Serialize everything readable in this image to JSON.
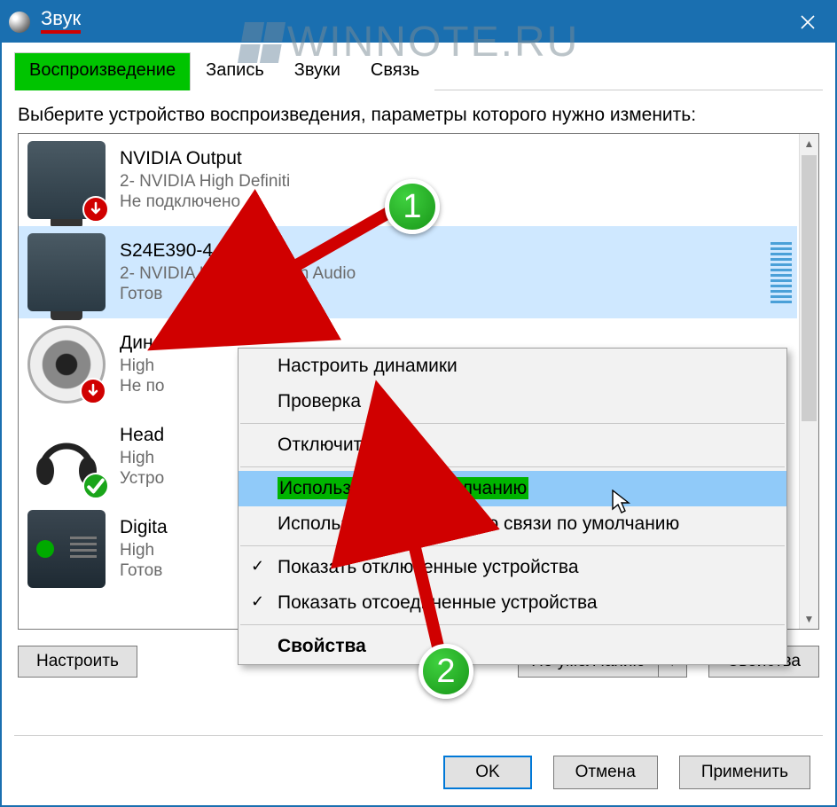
{
  "window": {
    "title": "Звук"
  },
  "watermark": "WINNOTE.RU",
  "tabs": {
    "playback": "Воспроизведение",
    "recording": "Запись",
    "sounds": "Звуки",
    "comm": "Связь"
  },
  "instruction": "Выберите устройство воспроизведения, параметры которого нужно изменить:",
  "devices": [
    {
      "name": "NVIDIA Output",
      "sub": "2- NVIDIA High Definiti",
      "status": "Не подключено"
    },
    {
      "name": "S24E390-4",
      "sub": "2- NVIDIA High Definition Audio",
      "status": "Готов"
    },
    {
      "name": "Дина",
      "sub": "High",
      "status": "Не по"
    },
    {
      "name": "Head",
      "sub": "High",
      "status": "Устро"
    },
    {
      "name": "Digita",
      "sub": "High",
      "status": "Готов"
    }
  ],
  "context_menu": {
    "configure": "Настроить динамики",
    "test": "Проверка",
    "disable": "Отключить",
    "set_default": "Использовать по умолчанию",
    "set_default_comm": "Использовать устройство связи по умолчанию",
    "show_disabled": "Показать отключенные устройства",
    "show_disconnected": "Показать отсоединенные устройства",
    "properties": "Свойства"
  },
  "buttons": {
    "configure": "Настроить",
    "set_default_split": "По умолчанию",
    "properties": "Свойства",
    "ok": "OK",
    "cancel": "Отмена",
    "apply": "Применить"
  },
  "annotations": {
    "step1": "1",
    "step2": "2"
  }
}
